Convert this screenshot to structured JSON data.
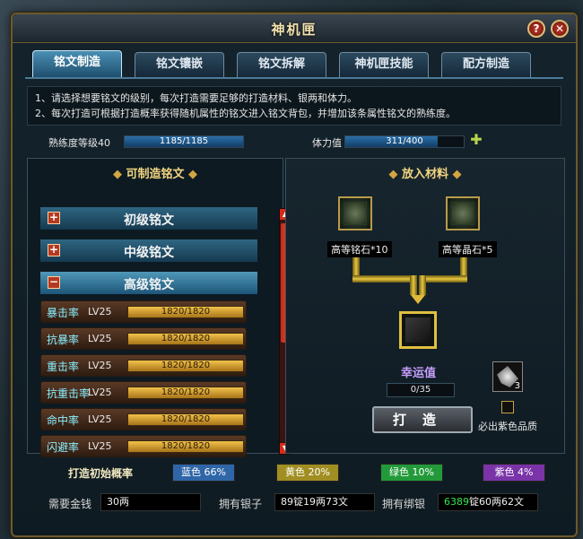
{
  "window": {
    "title": "神机匣"
  },
  "tabs": [
    {
      "label": "铭文制造",
      "active": true
    },
    {
      "label": "铭文镶嵌",
      "active": false
    },
    {
      "label": "铭文拆解",
      "active": false
    },
    {
      "label": "神机匣技能",
      "active": false
    },
    {
      "label": "配方制造",
      "active": false
    }
  ],
  "info": {
    "line1": "1、请选择想要铭文的级别，每次打造需要足够的打造材料、银两和体力。",
    "line2": "2、每次打造可根据打造概率获得随机属性的铭文进入铭文背包，并增加该条属性铭文的熟练度。"
  },
  "stats": {
    "proficiency_label": "熟练度等级40",
    "proficiency_value": "1185/1185",
    "proficiency_fraction": 1.0,
    "stamina_label": "体力值",
    "stamina_value": "311/400",
    "stamina_fraction": 0.7775
  },
  "left_panel": {
    "title": "可制造铭文",
    "categories": [
      {
        "label": "初级铭文",
        "toggle": "+"
      },
      {
        "label": "中级铭文",
        "toggle": "+"
      },
      {
        "label": "高级铭文",
        "toggle": "−"
      }
    ],
    "runes": [
      {
        "name": "暴击率",
        "level": "LV25",
        "progress": "1820/1820"
      },
      {
        "name": "抗暴率",
        "level": "LV25",
        "progress": "1820/1820"
      },
      {
        "name": "重击率",
        "level": "LV25",
        "progress": "1820/1820"
      },
      {
        "name": "抗重击率",
        "level": "LV25",
        "progress": "1820/1820"
      },
      {
        "name": "命中率",
        "level": "LV25",
        "progress": "1820/1820"
      },
      {
        "name": "闪避率",
        "level": "LV25",
        "progress": "1820/1820"
      }
    ]
  },
  "right_panel": {
    "title": "放入材料",
    "material1": "高等铭石*10",
    "material2": "高等晶石*5",
    "luck_title": "幸运值",
    "luck_value": "0/35",
    "forge_button": "打造",
    "item_count": "3",
    "guarantee_label": "必出紫色品质"
  },
  "probability": {
    "label": "打造初始概率",
    "blue": "蓝色 66%",
    "yellow": "黄色 20%",
    "green": "绿色 10%",
    "purple": "紫色 4%",
    "colors": {
      "blue": "#2f66a8",
      "yellow": "#a08e22",
      "green": "#239a3a",
      "purple": "#7a34a8"
    }
  },
  "footer": {
    "cost_label": "需要金钱",
    "cost_value": "30两",
    "silver_label": "拥有银子",
    "silver_value": "89锭19两73文",
    "bound_label": "拥有绑银",
    "bound_value_green": "6389",
    "bound_value_rest": "锭60两62文"
  }
}
